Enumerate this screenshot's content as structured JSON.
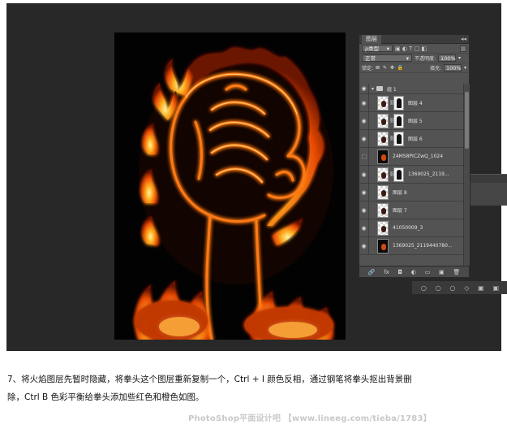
{
  "layers_panel": {
    "tab_label": "图层",
    "collapse_glyph": "◂◂",
    "filter_label": "ρ类型",
    "blend_mode": "正常",
    "opacity_label": "不透明度:",
    "opacity_value": "100%",
    "lock_label": "锁定:",
    "lock_icons": "⊠ ✎ ✥ 🔒",
    "fill_label": "填充:",
    "fill_value": "100%",
    "filter_icons": "▣ ◐ T ▢ ◧",
    "layers": [
      {
        "name": "组 1",
        "type": "group",
        "visible": true
      },
      {
        "name": "图层 4",
        "type": "layer-mask",
        "visible": true
      },
      {
        "name": "图层 5",
        "type": "layer-mask",
        "visible": true
      },
      {
        "name": "图层 6",
        "type": "layer-mask",
        "visible": true
      },
      {
        "name": "24MS8PICZwQ_1024",
        "type": "fire",
        "visible": false
      },
      {
        "name": "1369025_2119...",
        "type": "layer-mask",
        "visible": true
      },
      {
        "name": "图层 8",
        "type": "layer",
        "visible": true
      },
      {
        "name": "图层 7",
        "type": "layer",
        "visible": true
      },
      {
        "name": "41050009_3",
        "type": "layer",
        "visible": true
      },
      {
        "name": "1369025_2119440780...",
        "type": "fire",
        "visible": true
      }
    ],
    "footer_icons": [
      "🔗",
      "fx",
      "◘",
      "◐",
      "▭",
      "▣",
      "🗑"
    ]
  },
  "bottom_toolbar_icons": [
    "○",
    "○",
    "○",
    "◇",
    "▣",
    "▣"
  ],
  "caption": {
    "line1": "7、将火焰图层先暂时隐藏，将拳头这个图层重新复制一个，Ctrl + I 颜色反相，通过钢笔将拳头抠出背景删",
    "line2": "除，Ctrl B 色彩平衡给拳头添加些红色和橙色如图。"
  },
  "watermark": "PhotoShop平面设计吧 【www.lineeg.com/tieba/1783】",
  "colors": {
    "workspace": "#282828",
    "panel": "#535353",
    "fire_outer": "#ff6a00",
    "fire_core": "#ffd35a"
  }
}
